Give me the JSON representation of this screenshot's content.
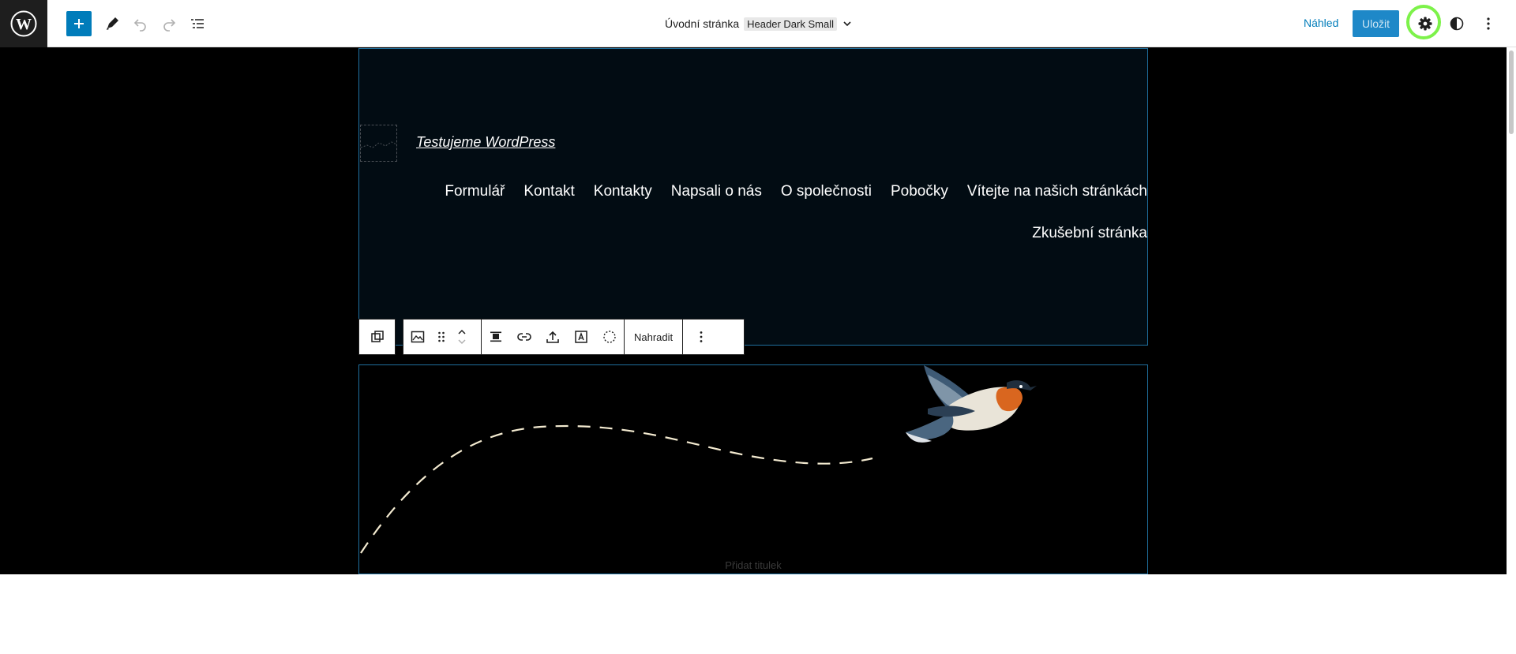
{
  "topbar": {
    "logo_icon": "wordpress-logo-icon",
    "add_icon": "plus-icon",
    "tools_icon": "pencil-icon",
    "undo_icon": "undo-icon",
    "redo_icon": "redo-icon",
    "list_view_icon": "list-view-icon",
    "document_title": "Úvodní stránka",
    "template_tag": "Header Dark Small",
    "preview_label": "Náhled",
    "save_label": "Uložit",
    "settings_icon": "gear-icon",
    "styles_icon": "half-circle-icon",
    "options_icon": "vertical-ellipsis-icon",
    "accent_color": "#007cba",
    "highlight_color": "#7df24a"
  },
  "header_block": {
    "site_title": "Testujeme WordPress",
    "nav_items_row1": [
      "Formulář",
      "Kontakt",
      "Kontakty",
      "Napsali o nás",
      "O společnosti",
      "Pobočky",
      "Vítejte na našich stránkách"
    ],
    "nav_items_row2": [
      "Zkušební stránka"
    ],
    "background_color": "#020c13"
  },
  "block_toolbar": {
    "select_parent_icon": "select-parent-icon",
    "image_icon": "image-icon",
    "drag_icon": "drag-handle-icon",
    "move_up_icon": "chevron-up-icon",
    "move_down_icon": "chevron-down-icon",
    "align_icon": "align-center-icon",
    "link_icon": "link-icon",
    "upload_icon": "upload-icon",
    "text_overlay_icon": "text-over-image-icon",
    "crop_icon": "circle-dashed-icon",
    "replace_label": "Nahradit",
    "more_icon": "vertical-ellipsis-icon"
  },
  "image_block": {
    "caption_placeholder": "Přidat titulek",
    "image_icon": "flying-bird-image"
  }
}
